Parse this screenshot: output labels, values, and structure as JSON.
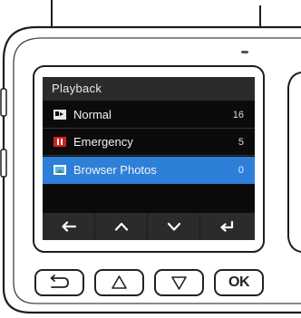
{
  "screen": {
    "title": "Playback",
    "items": [
      {
        "icon": "video-clip-icon",
        "label": "Normal",
        "count": "16",
        "selected": false
      },
      {
        "icon": "emergency-video-icon",
        "label": "Emergency",
        "count": "5",
        "selected": false
      },
      {
        "icon": "photo-icon",
        "label": "Browser Photos",
        "count": "0",
        "selected": true
      }
    ],
    "softkeys": [
      "back-arrow-icon",
      "up-chevron-icon",
      "down-chevron-icon",
      "enter-icon"
    ]
  },
  "hardware_buttons": {
    "back_icon": "return-arrow-icon",
    "up_icon": "up-triangle-icon",
    "down_icon": "down-triangle-icon",
    "ok_label": "OK"
  },
  "colors": {
    "screen_bg": "#0b0b0c",
    "title_bar": "#2b2b2e",
    "selection": "#2d7fd8",
    "emergency_icon": "#d81e1e"
  }
}
